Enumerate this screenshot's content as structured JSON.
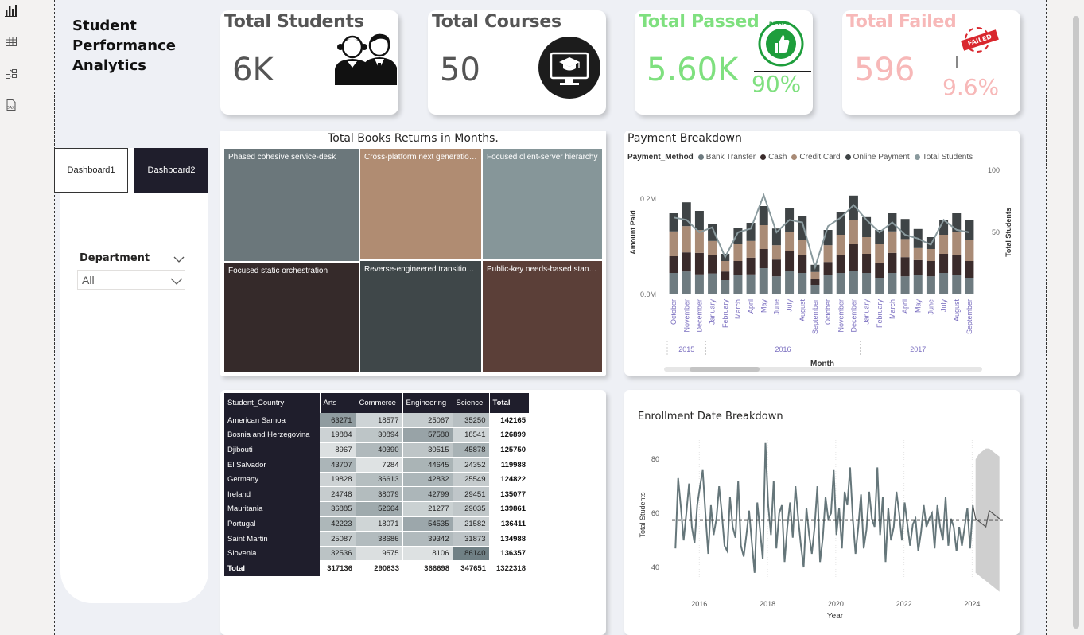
{
  "toolbar": {
    "icons": [
      "report-view-icon",
      "table-view-icon",
      "model-view-icon",
      "dax-query-icon"
    ]
  },
  "app": {
    "title": "Student\nPerformance\nAnalytics"
  },
  "nav": {
    "dashboard1": "Dashboard1",
    "dashboard2": "Dashboard2",
    "active": "Dashboard2"
  },
  "filter": {
    "label": "Department",
    "value": "All"
  },
  "kpis": {
    "students": {
      "title": "Total Students",
      "value": "6K",
      "icon": "students-icon"
    },
    "courses": {
      "title": "Total Courses",
      "value": "50",
      "icon": "graduation-monitor-icon"
    },
    "passed": {
      "title": "Total Passed",
      "value": "5.60K",
      "percent": "90%",
      "badge": "PASSED",
      "icon": "passed-stamp-icon"
    },
    "failed": {
      "title": "Total Failed",
      "value": "596",
      "percent": "9.6%",
      "badge": "FAILED",
      "icon": "failed-stamp-icon"
    }
  },
  "colors": {
    "bank_transfer": "#6e7b80",
    "cash": "#3a2b2b",
    "credit_card": "#a98b76",
    "online_payment": "#3f4446",
    "total_students": "#8a9a9e",
    "dark_header": "#1f1e2c",
    "passed_green": "#7fe07f",
    "failed_pink": "#f7b8b8"
  },
  "treemap": {
    "title": "Total Books Returns in Months.",
    "cells": [
      {
        "label": "Phased cohesive service-desk",
        "color": "#6b777b"
      },
      {
        "label": "Cross-platform next generation architecture",
        "color": "#b08c72"
      },
      {
        "label": "Focused client-server hierarchy",
        "color": "#869699"
      },
      {
        "label": "Focused static orchestration",
        "color": "#352a2a"
      },
      {
        "label": "Reverse-engineered transitional matrix",
        "color": "#3f4749"
      },
      {
        "label": "Public-key needs-based standardization",
        "color": "#5b3f38"
      }
    ]
  },
  "payment": {
    "title": "Payment Breakdown",
    "legend_title": "Payment_Method",
    "legend": [
      "Bank Transfer",
      "Cash",
      "Credit Card",
      "Online Payment",
      "Total Students"
    ],
    "y_left_label": "Amount Paid",
    "y_right_label": "Total Students",
    "x_label": "Month",
    "y_left_ticks": [
      "0.0M",
      "0.2M"
    ],
    "y_right_ticks": [
      "50",
      "100"
    ],
    "years": [
      "2015",
      "2016",
      "2017"
    ]
  },
  "matrix": {
    "row_header": "Student_Country",
    "columns": [
      "Arts",
      "Commerce",
      "Engineering",
      "Science",
      "Total"
    ],
    "rows": [
      {
        "country": "American Samoa",
        "values": [
          "63271",
          "18577",
          "25067",
          "35250"
        ],
        "total": "142165"
      },
      {
        "country": "Bosnia and Herzegovina",
        "values": [
          "19884",
          "30894",
          "57580",
          "18541"
        ],
        "total": "126899"
      },
      {
        "country": "Djibouti",
        "values": [
          "8967",
          "40390",
          "30515",
          "45878"
        ],
        "total": "125750"
      },
      {
        "country": "El Salvador",
        "values": [
          "43707",
          "7284",
          "44645",
          "24352"
        ],
        "total": "119988"
      },
      {
        "country": "Germany",
        "values": [
          "19828",
          "36613",
          "42832",
          "25549"
        ],
        "total": "124822"
      },
      {
        "country": "Ireland",
        "values": [
          "24748",
          "38079",
          "42799",
          "29451"
        ],
        "total": "135077"
      },
      {
        "country": "Mauritania",
        "values": [
          "36885",
          "52664",
          "21277",
          "29035"
        ],
        "total": "139861"
      },
      {
        "country": "Portugal",
        "values": [
          "42223",
          "18071",
          "54535",
          "21582"
        ],
        "total": "136411"
      },
      {
        "country": "Saint Martin",
        "values": [
          "25087",
          "38686",
          "39342",
          "31873"
        ],
        "total": "134988"
      },
      {
        "country": "Slovenia",
        "values": [
          "32536",
          "9575",
          "8106",
          "86140"
        ],
        "total": "136357"
      }
    ],
    "totals": {
      "label": "Total",
      "values": [
        "317136",
        "290833",
        "366698",
        "347651"
      ],
      "total": "1322318"
    }
  },
  "enrollment": {
    "title": "Enrollment Date Breakdown",
    "y_label": "Total Students",
    "x_label": "Year"
  },
  "chart_data": [
    {
      "type": "bar",
      "title": "Payment Breakdown",
      "xlabel": "Month",
      "ylabel": "Amount Paid",
      "y2label": "Total Students",
      "ylim": [
        0,
        260000
      ],
      "y2lim": [
        0,
        100
      ],
      "categories": [
        "October",
        "November",
        "December",
        "January",
        "February",
        "March",
        "April",
        "May",
        "June",
        "July",
        "August",
        "September",
        "October",
        "November",
        "December",
        "January",
        "February",
        "March",
        "April",
        "May",
        "June",
        "July",
        "August",
        "September"
      ],
      "category_years": [
        "2015",
        "2015",
        "2015",
        "2016",
        "2016",
        "2016",
        "2016",
        "2016",
        "2016",
        "2016",
        "2016",
        "2016",
        "2016",
        "2016",
        "2016",
        "2017",
        "2017",
        "2017",
        "2017",
        "2017",
        "2017",
        "2017",
        "2017",
        "2017"
      ],
      "series": [
        {
          "name": "Bank Transfer",
          "values": [
            45000,
            48000,
            42000,
            44000,
            30000,
            40000,
            42000,
            55000,
            38000,
            50000,
            45000,
            20000,
            40000,
            45000,
            50000,
            45000,
            35000,
            45000,
            38000,
            40000,
            38000,
            45000,
            40000,
            35000
          ]
        },
        {
          "name": "Cash",
          "values": [
            35000,
            40000,
            45000,
            38000,
            18000,
            30000,
            35000,
            40000,
            35000,
            40000,
            38000,
            12000,
            28000,
            38000,
            55000,
            40000,
            30000,
            42000,
            40000,
            32000,
            32000,
            40000,
            42000,
            35000
          ]
        },
        {
          "name": "Credit Card",
          "values": [
            52000,
            55000,
            48000,
            30000,
            22000,
            35000,
            35000,
            50000,
            30000,
            40000,
            32000,
            15000,
            35000,
            42000,
            50000,
            35000,
            40000,
            45000,
            38000,
            25000,
            25000,
            40000,
            48000,
            45000
          ]
        },
        {
          "name": "Online Payment",
          "values": [
            38000,
            50000,
            40000,
            35000,
            15000,
            35000,
            38000,
            40000,
            35000,
            50000,
            50000,
            15000,
            32000,
            48000,
            52000,
            42000,
            30000,
            38000,
            42000,
            40000,
            25000,
            30000,
            40000,
            40000
          ]
        }
      ],
      "line": {
        "name": "Total Students",
        "values": [
          62,
          60,
          50,
          54,
          30,
          50,
          53,
          80,
          50,
          60,
          58,
          22,
          55,
          62,
          72,
          60,
          50,
          58,
          48,
          45,
          40,
          60,
          52,
          50
        ]
      },
      "legend": "top-left"
    },
    {
      "type": "line",
      "title": "Enrollment Date Breakdown",
      "xlabel": "Year",
      "ylabel": "Total Students",
      "ylim": [
        35,
        88
      ],
      "xlim": [
        2015.2,
        2024.9
      ],
      "x_ticks": [
        2016,
        2018,
        2020,
        2022,
        2024
      ],
      "y_ticks": [
        40,
        60,
        80
      ],
      "trend_value": 57.5,
      "x": [
        2015.3,
        2015.38,
        2015.46,
        2015.54,
        2015.62,
        2015.7,
        2015.78,
        2015.86,
        2015.94,
        2016.02,
        2016.1,
        2016.18,
        2016.26,
        2016.34,
        2016.42,
        2016.5,
        2016.58,
        2016.66,
        2016.74,
        2016.82,
        2016.9,
        2016.98,
        2017.06,
        2017.14,
        2017.22,
        2017.3,
        2017.38,
        2017.46,
        2017.54,
        2017.62,
        2017.7,
        2017.78,
        2017.86,
        2017.94,
        2018.02,
        2018.1,
        2018.18,
        2018.26,
        2018.34,
        2018.42,
        2018.5,
        2018.58,
        2018.66,
        2018.74,
        2018.82,
        2018.9,
        2018.98,
        2019.06,
        2019.14,
        2019.22,
        2019.3,
        2019.38,
        2019.46,
        2019.54,
        2019.62,
        2019.7,
        2019.78,
        2019.86,
        2019.94,
        2020.02,
        2020.1,
        2020.18,
        2020.26,
        2020.34,
        2020.42,
        2020.5,
        2020.58,
        2020.66,
        2020.74,
        2020.82,
        2020.9,
        2020.98,
        2021.06,
        2021.14,
        2021.22,
        2021.3,
        2021.38,
        2021.46,
        2021.54,
        2021.62,
        2021.7,
        2021.78,
        2021.86,
        2021.94,
        2022.02,
        2022.1,
        2022.18,
        2022.26,
        2022.34,
        2022.42,
        2022.5,
        2022.58,
        2022.66,
        2022.74,
        2022.82,
        2022.9,
        2022.98,
        2023.06,
        2023.14,
        2023.22,
        2023.3,
        2023.38,
        2023.46,
        2023.54,
        2023.62,
        2023.7,
        2023.78,
        2023.86,
        2023.94,
        2024.02
      ],
      "values": [
        47,
        73,
        62,
        50,
        60,
        71,
        55,
        49,
        63,
        70,
        76,
        60,
        45,
        63,
        52,
        58,
        70,
        60,
        48,
        46,
        66,
        55,
        51,
        72,
        48,
        44,
        52,
        61,
        49,
        38,
        64,
        54,
        43,
        86,
        63,
        52,
        72,
        47,
        60,
        63,
        42,
        55,
        64,
        51,
        70,
        58,
        48,
        40,
        62,
        52,
        45,
        55,
        70,
        42,
        51,
        66,
        58,
        60,
        76,
        52,
        62,
        47,
        68,
        63,
        77,
        58,
        45,
        55,
        67,
        47,
        54,
        68,
        58,
        55,
        77,
        52,
        66,
        42,
        62,
        50,
        55,
        68,
        60,
        50,
        64,
        56,
        48,
        56,
        58,
        46,
        53,
        63,
        55,
        58,
        60,
        47,
        63,
        55,
        50,
        66,
        48,
        58,
        55,
        46,
        55,
        48,
        55,
        62,
        47,
        63
      ],
      "forecast_x": [
        2024.1,
        2024.2,
        2024.3,
        2024.4,
        2024.5,
        2024.6,
        2024.7,
        2024.8
      ],
      "forecast_values": [
        58,
        57,
        56,
        55,
        61,
        60,
        59,
        58
      ],
      "forecast_upper": [
        80,
        82,
        83,
        84,
        84,
        83,
        82,
        81
      ],
      "forecast_lower": [
        38,
        37,
        36,
        35,
        34,
        33,
        32,
        31
      ]
    }
  ]
}
